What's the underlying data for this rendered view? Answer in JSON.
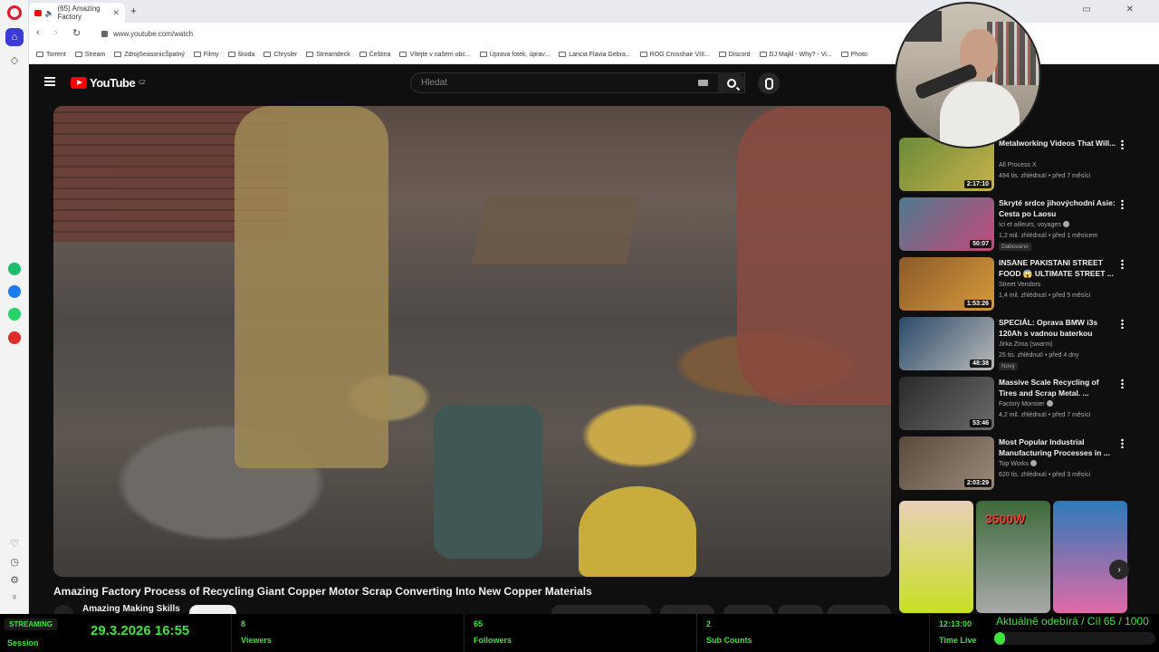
{
  "browser": {
    "tab_title": "(65) Amazing Factory",
    "url": "www.youtube.com/watch",
    "bookmarks": [
      "Torrent",
      "Stream",
      "ZdrojSeasonicŠpatný",
      "Filmy",
      "škoda",
      "Chrysler",
      "Streamdeck",
      "Čeština",
      "Vítejte v našem obc...",
      "Úprava fotek, úprav...",
      "Lancia Flavia Gebra...",
      "ROG Crosshair VIII...",
      "Discord",
      "DJ Majkl - Why? - Vi...",
      "Photo"
    ]
  },
  "youtube": {
    "logo_text": "YouTube",
    "region": "CZ",
    "search_placeholder": "Hledat",
    "video_title": "Amazing Factory Process of Recycling Giant Copper Motor Scrap Converting Into New Copper Materials",
    "channel_name": "Amazing Making Skills",
    "recommendations": [
      {
        "title": "Metalworking Videos That Will...",
        "channel": "All Process X",
        "views": "494 tis. zhlédnutí • před 7 měsíci",
        "duration": "2:17:10",
        "verified": false,
        "badge": "",
        "extra": "",
        "color1": "#6b8a3a",
        "color2": "#c8b24a"
      },
      {
        "title": "Skryté srdce jihovýchodní Asie: Cesta po Laosu",
        "channel": "Ici et ailleurs, voyages",
        "views": "1,2 mil. zhlédnutí • před 1 měsícem",
        "duration": "50:07",
        "verified": true,
        "badge": "",
        "extra": "Dabováno",
        "color1": "#4f7a8f",
        "color2": "#c44a7a"
      },
      {
        "title": "INSANE PAKISTANI STREET FOOD 😱 ULTIMATE STREET ...",
        "channel": "Street Vendors",
        "views": "1,4 mil. zhlédnutí • před 5 měsíci",
        "duration": "1:53:26",
        "verified": false,
        "badge": "",
        "extra": "",
        "color1": "#8a5a2a",
        "color2": "#d79a3a"
      },
      {
        "title": "SPECIÁL: Oprava BMW i3s 120Ah s vadnou baterkou",
        "channel": "Jirka Zima (swarm)",
        "views": "25 tis. zhlédnutí • před 4 dny",
        "duration": "48:38",
        "verified": false,
        "badge": "Nový",
        "extra": "",
        "color1": "#2a4a6a",
        "color2": "#b9b9b9"
      },
      {
        "title": "Massive Scale Recycling of Tires and Scrap Metal. ...",
        "channel": "Factory Monster",
        "views": "4,2 mil. zhlédnutí • před 7 měsíci",
        "duration": "53:46",
        "verified": true,
        "badge": "",
        "extra": "",
        "color1": "#2a2a2a",
        "color2": "#6a6a6a"
      },
      {
        "title": "Most Popular Industrial Manufacturing Processes in ...",
        "channel": "Top Works",
        "views": "620 tis. zhlédnutí • před 3 měsíci",
        "duration": "2:03:29",
        "verified": true,
        "badge": "",
        "extra": "",
        "color1": "#5a4a3a",
        "color2": "#9a8a7a"
      }
    ],
    "shorts": [
      {
        "label": "",
        "label_top": "",
        "color1": "#e8d0b8",
        "color2": "#c8e024"
      },
      {
        "label": "3500W",
        "label_top": "",
        "color1": "#3d6a3a",
        "color2": "#a9a9a9"
      },
      {
        "label": "",
        "label_top": "",
        "color1": "#2d7ab8",
        "color2": "#e06aa8"
      }
    ]
  },
  "stream": {
    "live_label": "STREAMING",
    "session_label": "Session",
    "datetime": "29.3.2026 16:55",
    "viewers_value": "8",
    "viewers_label": "Viewers",
    "followers_value": "65",
    "followers_label": "Followers",
    "subs_value": "2",
    "subs_label": "Sub Counts",
    "time_value": "12:13:00",
    "time_label": "Time Live",
    "goal_text": "Aktuálně odebírá / Cíl  65 / 1000",
    "goal_progress": 0.065
  },
  "colors": {
    "accent_green": "#3fe23f",
    "youtube_red": "#ff0000",
    "opera_red": "#e01a2b"
  }
}
